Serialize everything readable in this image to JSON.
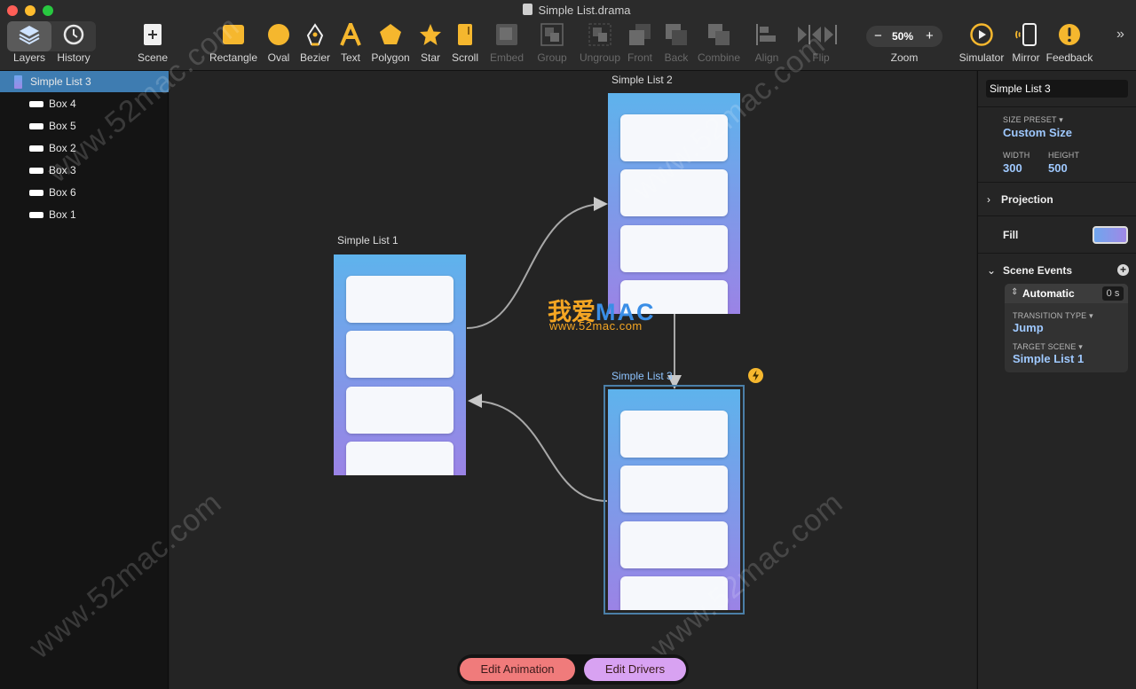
{
  "window": {
    "title": "Simple List.drama"
  },
  "toolbar": {
    "layers": "Layers",
    "history": "History",
    "scene": "Scene",
    "rectangle": "Rectangle",
    "oval": "Oval",
    "bezier": "Bezier",
    "text": "Text",
    "polygon": "Polygon",
    "star": "Star",
    "scroll": "Scroll",
    "embed": "Embed",
    "group": "Group",
    "ungroup": "Ungroup",
    "front": "Front",
    "back": "Back",
    "combine": "Combine",
    "align": "Align",
    "flip": "Flip",
    "zoom": "Zoom",
    "zoom_value": "50%",
    "simulator": "Simulator",
    "mirror": "Mirror",
    "feedback": "Feedback",
    "more": "»"
  },
  "layers": {
    "selected": "Simple List 3",
    "children": [
      "Box 4",
      "Box 5",
      "Box 2",
      "Box 3",
      "Box 6",
      "Box 1"
    ]
  },
  "canvas": {
    "scenes": [
      {
        "name": "Simple List 1"
      },
      {
        "name": "Simple List 2"
      },
      {
        "name": "Simple List 3"
      }
    ],
    "trigger_icon": "lightning-icon"
  },
  "watermark": {
    "logo_cn": "我爱",
    "logo_en": "MAC",
    "url": "www.52mac.com",
    "diag": "www.52mac.com"
  },
  "inspector": {
    "name": "Simple List 3",
    "size_preset_label": "SIZE PRESET",
    "size_preset_value": "Custom Size",
    "width_label": "WIDTH",
    "width": "300",
    "height_label": "HEIGHT",
    "height": "500",
    "projection": "Projection",
    "fill": "Fill",
    "fill_color_start": "#6fa6ee",
    "fill_color_end": "#a088e6",
    "scene_events": "Scene Events",
    "event_type": "Automatic",
    "event_delay": "0 s",
    "transition_label": "TRANSITION TYPE",
    "transition_value": "Jump",
    "target_label": "TARGET SCENE",
    "target_value": "Simple List 1"
  },
  "bottom": {
    "edit_animation": "Edit Animation",
    "edit_drivers": "Edit Drivers"
  },
  "colors": {
    "accent": "#9fc9ff",
    "selection": "#3e7cb1",
    "animation_pill": "#f07b7b",
    "drivers_pill": "#d8a2f2"
  }
}
